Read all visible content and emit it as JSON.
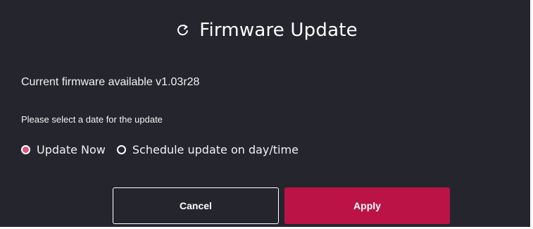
{
  "dialog": {
    "title": "Firmware Update",
    "title_icon": "refresh-icon",
    "current_firmware_text": "Current firmware available v1.03r28",
    "select_date_label": "Please select a date for the update",
    "options": [
      {
        "label": "Update Now",
        "selected": true
      },
      {
        "label": "Schedule update on day/time",
        "selected": false
      }
    ],
    "buttons": {
      "cancel_label": "Cancel",
      "apply_label": "Apply"
    }
  },
  "colors": {
    "background": "#25262d",
    "accent": "#bc1346",
    "radio_selected": "#e0557e",
    "text": "#ffffff"
  }
}
